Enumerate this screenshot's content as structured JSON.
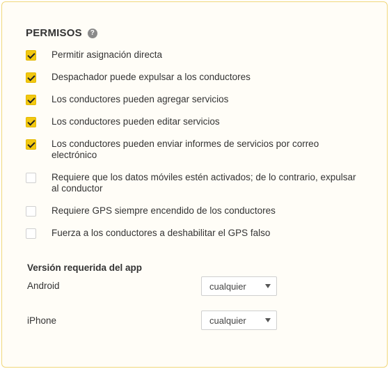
{
  "permissions": {
    "title": "PERMISOS",
    "help_icon_glyph": "?",
    "items": [
      {
        "label": "Permitir asignación directa",
        "checked": true
      },
      {
        "label": "Despachador puede expulsar a los conductores",
        "checked": true
      },
      {
        "label": "Los conductores pueden agregar servicios",
        "checked": true
      },
      {
        "label": "Los conductores pueden editar servicios",
        "checked": true
      },
      {
        "label": "Los conductores pueden enviar informes de servicios por correo electrónico",
        "checked": true
      },
      {
        "label": "Requiere que los datos móviles estén activados; de lo contrario, expulsar al conductor",
        "checked": false
      },
      {
        "label": "Requiere GPS siempre encendido de los conductores",
        "checked": false
      },
      {
        "label": "Fuerza a los conductores a deshabilitar el GPS falso",
        "checked": false
      }
    ]
  },
  "app_version": {
    "title": "Versión requerida del app",
    "android": {
      "label": "Android",
      "value": "cualquier"
    },
    "iphone": {
      "label": "iPhone",
      "value": "cualquier"
    }
  },
  "colors": {
    "accent": "#f2c811",
    "panel_border": "#f0d77a"
  }
}
